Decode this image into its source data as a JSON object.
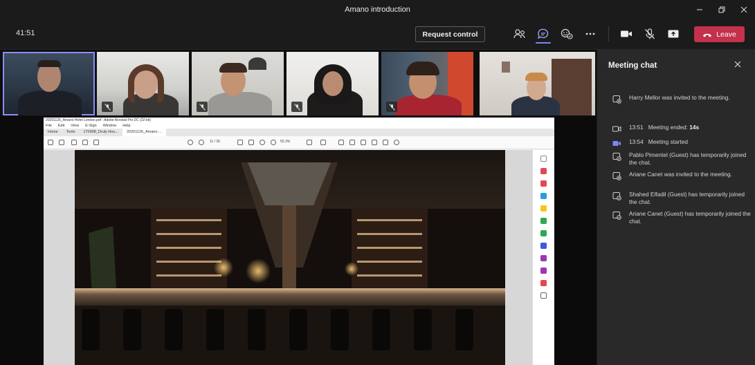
{
  "window": {
    "title": "Amano introduction"
  },
  "toolbar": {
    "timer": "41:51",
    "request_control_label": "Request control",
    "leave_label": "Leave"
  },
  "chat": {
    "title": "Meeting chat",
    "messages": [
      {
        "type": "invite",
        "text": "Harry Mellor was invited to the meeting."
      },
      {
        "type": "ended",
        "time": "13:51",
        "text": "Meeting ended:",
        "duration": "14s"
      },
      {
        "type": "started",
        "time": "13:54",
        "text": "Meeting started"
      },
      {
        "type": "join",
        "text": "Pablo Pimentel (Guest) has temporarily joined the chat."
      },
      {
        "type": "invite",
        "text": "Ariane Canet was invited to the meeting."
      },
      {
        "type": "join",
        "text": "Shahed Elfadil (Guest) has temporarily joined the chat."
      },
      {
        "type": "join",
        "text": "Ariane Canet (Guest) has temporarily joined the chat."
      }
    ]
  },
  "shared_window": {
    "title_bar": "20201126_Amano Hotel London.pdf - Adobe Acrobat Pro DC (32-bit)",
    "menu": [
      "File",
      "Edit",
      "View",
      "E-Sign",
      "Window",
      "Help"
    ],
    "tabs": [
      "Home",
      "Tools",
      "170908_Druly Hou...",
      "20201126_Amano ..."
    ],
    "page_indicator": "11 / 30",
    "zoom": "55.3%"
  },
  "colors": {
    "accent": "#7f85f5",
    "leave": "#c4314b",
    "panel": "#292929",
    "background": "#1b1b1b"
  }
}
